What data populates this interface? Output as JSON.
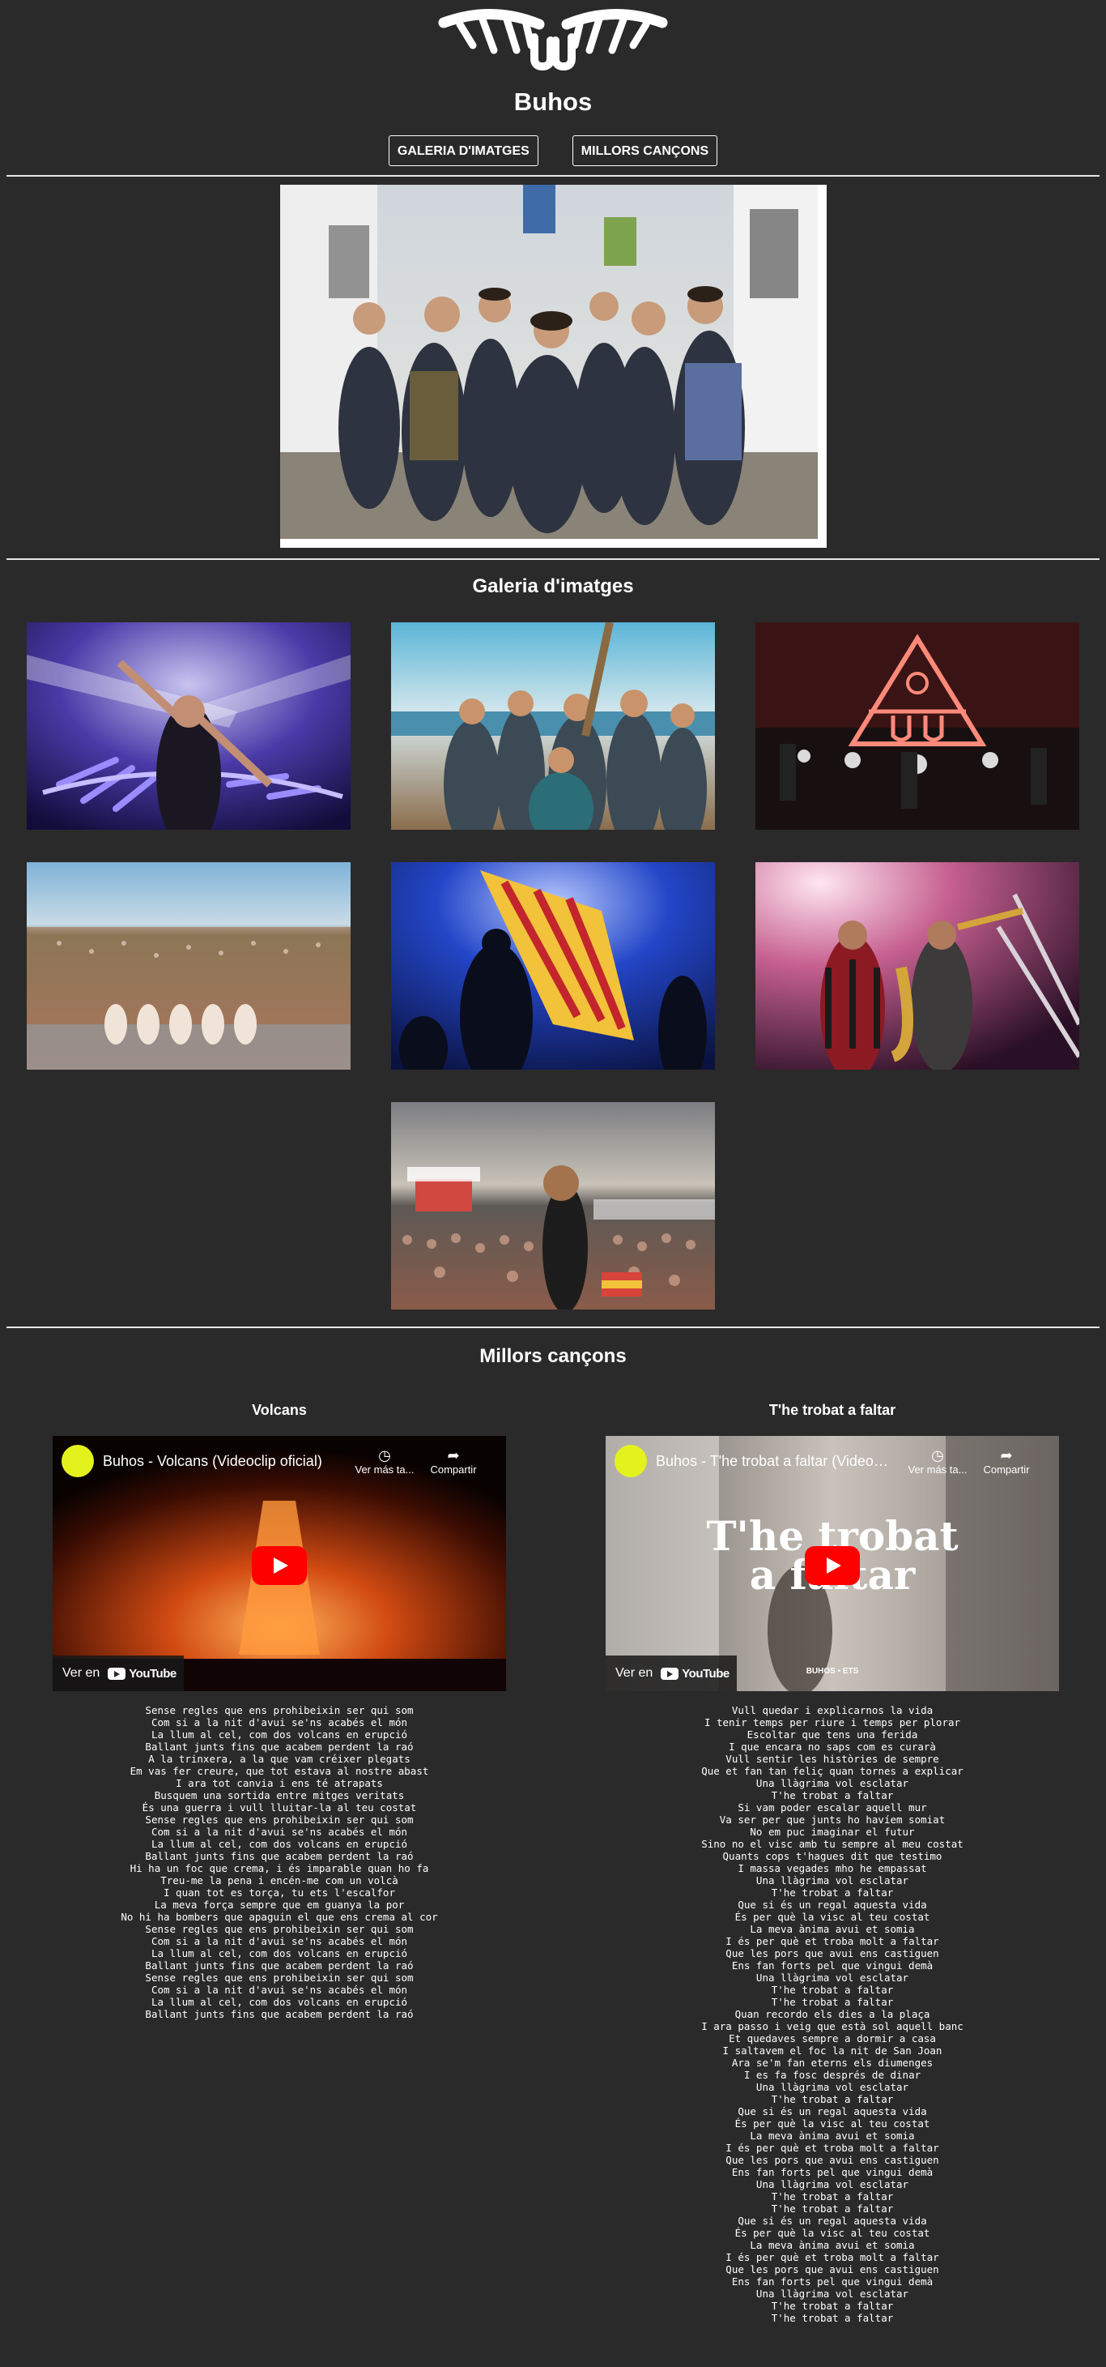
{
  "header": {
    "title": "Buhos",
    "nav": [
      "GALERIA D'IMATGES",
      "MILLORS CANÇONS"
    ]
  },
  "gallery": {
    "heading": "Galeria d'imatges"
  },
  "songs_section": {
    "heading": "Millors cançons",
    "songs": [
      {
        "title": "Volcans",
        "video_title": "Buhos - Volcans (Videoclip oficial)",
        "watch_later": "Ver más ta...",
        "share": "Compartir",
        "watch_on": "Ver en",
        "youtube": "YouTube",
        "lyrics": [
          "Sense regles que ens prohibeixin ser qui som",
          "Com si a la nit d'avui se'ns acabés el món",
          "La llum al cel, com dos volcans en erupció",
          "Ballant junts fins que acabem perdent la raó",
          "A la trinxera, a la que vam créixer plegats",
          "Em vas fer creure, que tot estava al nostre abast",
          "I ara tot canvia i ens té atrapats",
          "Busquem una sortida entre mitges veritats",
          "És una guerra i vull lluitar-la al teu costat",
          "Sense regles que ens prohibeixin ser qui som",
          "Com si a la nit d'avui se'ns acabés el món",
          "La llum al cel, com dos volcans en erupció",
          "Ballant junts fins que acabem perdent la raó",
          "Hi ha un foc que crema, i és imparable quan ho fa",
          "Treu-me la pena i encén-me com un volcà",
          "I quan tot es torça, tu ets l'escalfor",
          "La meva força sempre que em guanya la por",
          "No hi ha bombers que apaguin el que ens crema al cor",
          "Sense regles que ens prohibeixin ser qui som",
          "Com si a la nit d'avui se'ns acabés el món",
          "La llum al cel, com dos volcans en erupció",
          "Ballant junts fins que acabem perdent la raó",
          "Sense regles que ens prohibeixin ser qui som",
          "Com si a la nit d'avui se'ns acabés el món",
          "La llum al cel, com dos volcans en erupció",
          "Ballant junts fins que acabem perdent la raó"
        ]
      },
      {
        "title": "T'he trobat a faltar",
        "video_title": "Buhos - T'he trobat a faltar (Videocli...",
        "watch_later": "Ver más ta...",
        "share": "Compartir",
        "watch_on": "Ver en",
        "youtube": "YouTube",
        "thumb_line1": "T'he trobat",
        "thumb_line2": "a faltar",
        "thumb_credit": "BUHOS • ETS",
        "lyrics": [
          "Vull quedar i explicarnos la vida",
          "I tenir temps per riure i temps per plorar",
          "Escoltar que tens una ferida",
          "I que encara no saps com es curarà",
          "Vull sentir les històries de sempre",
          "Que et fan tan feliç quan tornes a explicar",
          "Una llàgrima vol esclatar",
          "T'he trobat a faltar",
          "Si vam poder escalar aquell mur",
          "Va ser per que junts ho havíem somiat",
          "No em puc imaginar el futur",
          "Sino no el visc amb tu sempre al meu costat",
          "Quants cops t'hagues dit que testimo",
          "I massa vegades mho he empassat",
          "Una llàgrima vol esclatar",
          "T'he trobat a faltar",
          "Que si és un regal aquesta vida",
          "És per què la visc al teu costat",
          "La meva ànima avui et somia",
          "I és per què et troba molt a faltar",
          "Que les pors que avui ens castiguen",
          "Ens fan forts pel que vingui demà",
          "Una llàgrima vol esclatar",
          "T'he trobat a faltar",
          "T'he trobat a faltar",
          "Quan recordo els dies a la plaça",
          "I ara passo i veig que està sol aquell banc",
          "Et quedaves sempre a dormir a casa",
          "I saltavem el foc la nit de San Joan",
          "Ara se'm fan eterns els diumenges",
          "I es fa fosc després de dinar",
          "Una llàgrima vol esclatar",
          "T'he trobat a faltar",
          "Que si és un regal aquesta vida",
          "És per què la visc al teu costat",
          "La meva ànima avui et somia",
          "I és per què et troba molt a faltar",
          "Que les pors que avui ens castiguen",
          "Ens fan forts pel que vingui demà",
          "Una llàgrima vol esclatar",
          "T'he trobat a faltar",
          "T'he trobat a faltar",
          "Que si és un regal aquesta vida",
          "És per què la visc al teu costat",
          "La meva ànima avui et somia",
          "I és per què et troba molt a faltar",
          "Que les pors que avui ens castiguen",
          "Ens fan forts pel que vingui demà",
          "Una llàgrima vol esclatar",
          "T'he trobat a faltar",
          "T'he trobat a faltar"
        ]
      }
    ]
  },
  "icons": {
    "logo": "owl-eyes-logo",
    "watch_later": "clock-icon",
    "share": "share-arrow-icon",
    "play": "youtube-play-icon"
  },
  "colors": {
    "background": "#2a2a2a",
    "text": "#ffffff",
    "youtube_red": "#ff0000",
    "channel_badge": "#e3f21d"
  }
}
